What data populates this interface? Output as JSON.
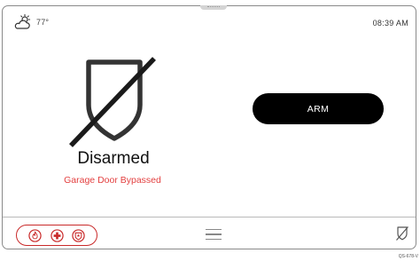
{
  "header": {
    "weather_icon": "partly-cloudy-icon",
    "temperature": "77°",
    "time": "08:39 AM"
  },
  "status": {
    "icon": "shield-slash-icon",
    "title": "Disarmed",
    "subtitle": "Garage Door Bypassed",
    "subtitle_color": "#e34040"
  },
  "arm_button": {
    "label": "ARM",
    "color": "#000000"
  },
  "footer": {
    "emergency_color": "#c92a2a",
    "emergency_icons": [
      "fire-icon",
      "medical-icon",
      "police-icon"
    ],
    "menu_icon": "hamburger-menu-icon",
    "status_icon": "shield-slash-icon"
  },
  "document_id": "QS-678-V"
}
